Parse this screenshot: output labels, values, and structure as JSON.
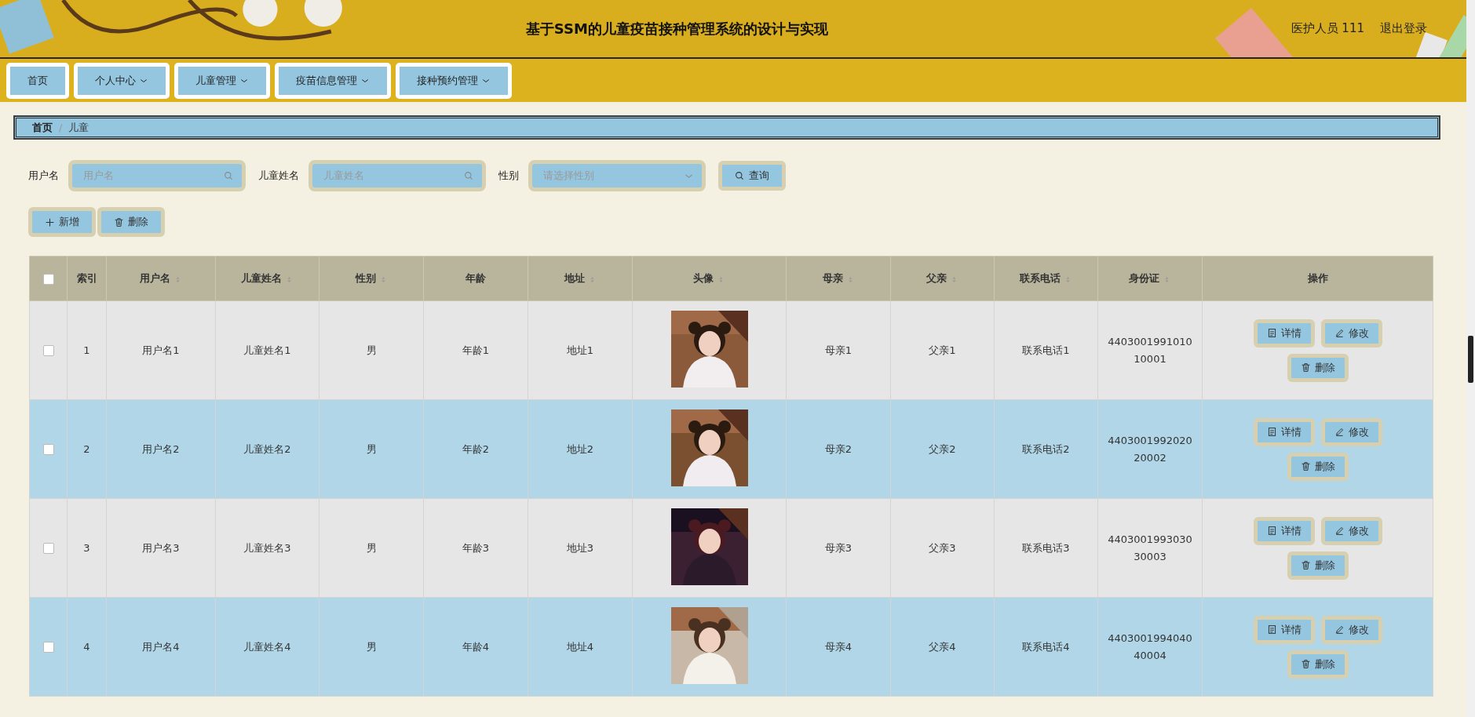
{
  "header": {
    "title": "基于SSM的儿童疫苗接种管理系统的设计与实现",
    "user": "医护人员 111",
    "logout": "退出登录"
  },
  "nav": [
    {
      "label": "首页",
      "dropdown": false
    },
    {
      "label": "个人中心",
      "dropdown": true
    },
    {
      "label": "儿童管理",
      "dropdown": true
    },
    {
      "label": "疫苗信息管理",
      "dropdown": true
    },
    {
      "label": "接种预约管理",
      "dropdown": true
    }
  ],
  "breadcrumb": [
    "首页",
    "儿童"
  ],
  "breadcrumb_separator": "/",
  "filters": [
    {
      "label": "用户名",
      "placeholder": "用户名",
      "kind": "search"
    },
    {
      "label": "儿童姓名",
      "placeholder": "儿童姓名",
      "kind": "search"
    },
    {
      "label": "性别",
      "placeholder": "请选择性别",
      "kind": "select"
    }
  ],
  "search_button": "查询",
  "actions": [
    {
      "label": "新增",
      "kind": "add"
    },
    {
      "label": "删除",
      "kind": "delete"
    }
  ],
  "table": {
    "select_all_checked": false,
    "columns": [
      {
        "label": "索引",
        "sortable": false
      },
      {
        "label": "用户名",
        "sortable": true
      },
      {
        "label": "儿童姓名",
        "sortable": true
      },
      {
        "label": "性别",
        "sortable": true
      },
      {
        "label": "年龄",
        "sortable": false
      },
      {
        "label": "地址",
        "sortable": true
      },
      {
        "label": "头像",
        "sortable": true
      },
      {
        "label": "母亲",
        "sortable": true
      },
      {
        "label": "父亲",
        "sortable": true
      },
      {
        "label": "联系电话",
        "sortable": true
      },
      {
        "label": "身份证",
        "sortable": true
      },
      {
        "label": "操作",
        "sortable": false
      }
    ],
    "rows": [
      {
        "checked": false,
        "cells": [
          "1",
          "用户名1",
          "儿童姓名1",
          "男",
          "年龄1",
          "地址1",
          {
            "kind": "picture"
          },
          "母亲1",
          "父亲1",
          "联系电话1",
          "440300199101010001"
        ],
        "buttons": [
          {
            "label": "详情",
            "kind": "detail"
          },
          {
            "label": "修改",
            "kind": "edit"
          },
          {
            "label": "删除",
            "kind": "delete"
          }
        ]
      },
      {
        "checked": false,
        "cells": [
          "2",
          "用户名2",
          "儿童姓名2",
          "男",
          "年龄2",
          "地址2",
          {
            "kind": "picture"
          },
          "母亲2",
          "父亲2",
          "联系电话2",
          "440300199202020002"
        ],
        "buttons": [
          {
            "label": "详情",
            "kind": "detail"
          },
          {
            "label": "修改",
            "kind": "edit"
          },
          {
            "label": "删除",
            "kind": "delete"
          }
        ]
      },
      {
        "checked": false,
        "cells": [
          "3",
          "用户名3",
          "儿童姓名3",
          "男",
          "年龄3",
          "地址3",
          {
            "kind": "picture"
          },
          "母亲3",
          "父亲3",
          "联系电话3",
          "440300199303030003"
        ],
        "buttons": [
          {
            "label": "详情",
            "kind": "detail"
          },
          {
            "label": "修改",
            "kind": "edit"
          },
          {
            "label": "删除",
            "kind": "delete"
          }
        ]
      },
      {
        "checked": false,
        "cells": [
          "4",
          "用户名4",
          "儿童姓名4",
          "男",
          "年龄4",
          "地址4",
          {
            "kind": "picture"
          },
          "母亲4",
          "父亲4",
          "联系电话4",
          "440300199404040004"
        ],
        "buttons": [
          {
            "label": "详情",
            "kind": "detail"
          },
          {
            "label": "修改",
            "kind": "edit"
          },
          {
            "label": "删除",
            "kind": "delete"
          }
        ]
      }
    ]
  }
}
